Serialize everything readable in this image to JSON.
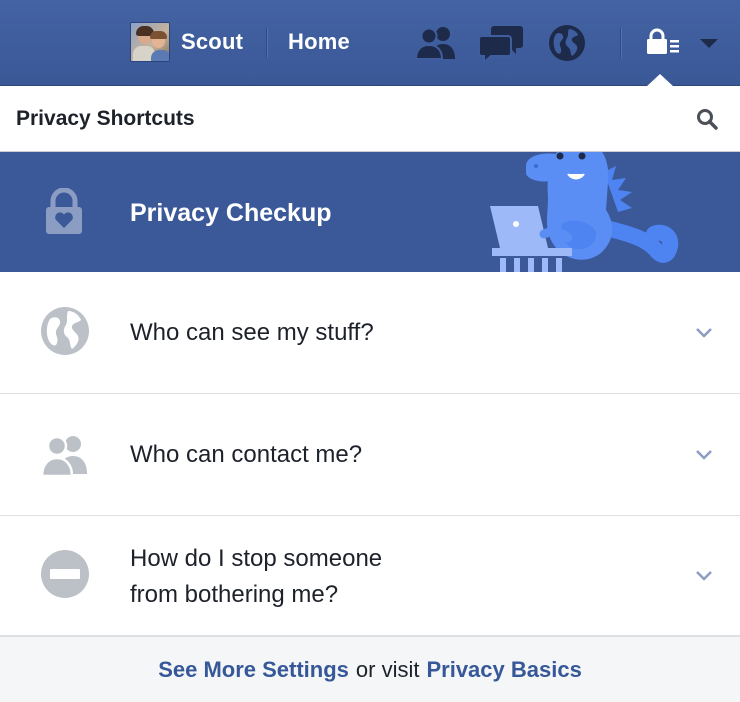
{
  "topbar": {
    "profile_name": "Scout",
    "home_label": "Home",
    "icons": [
      "friend-requests-icon",
      "messages-icon",
      "notifications-globe-icon",
      "privacy-lock-icon",
      "account-caret-icon"
    ],
    "background": "#3b5998"
  },
  "header": {
    "title": "Privacy Shortcuts"
  },
  "checkup": {
    "label": "Privacy Checkup",
    "background": "#3b5998"
  },
  "rows": [
    {
      "label": "Who can see my stuff?",
      "icon": "globe-icon"
    },
    {
      "label": "Who can contact me?",
      "icon": "people-icon"
    },
    {
      "label_line1": "How do I stop someone",
      "label_line2": "from bothering me?",
      "icon": "block-icon"
    }
  ],
  "footer": {
    "link1": "See More Settings",
    "middle": "or visit",
    "link2": "Privacy Basics",
    "link_color": "#365899"
  }
}
